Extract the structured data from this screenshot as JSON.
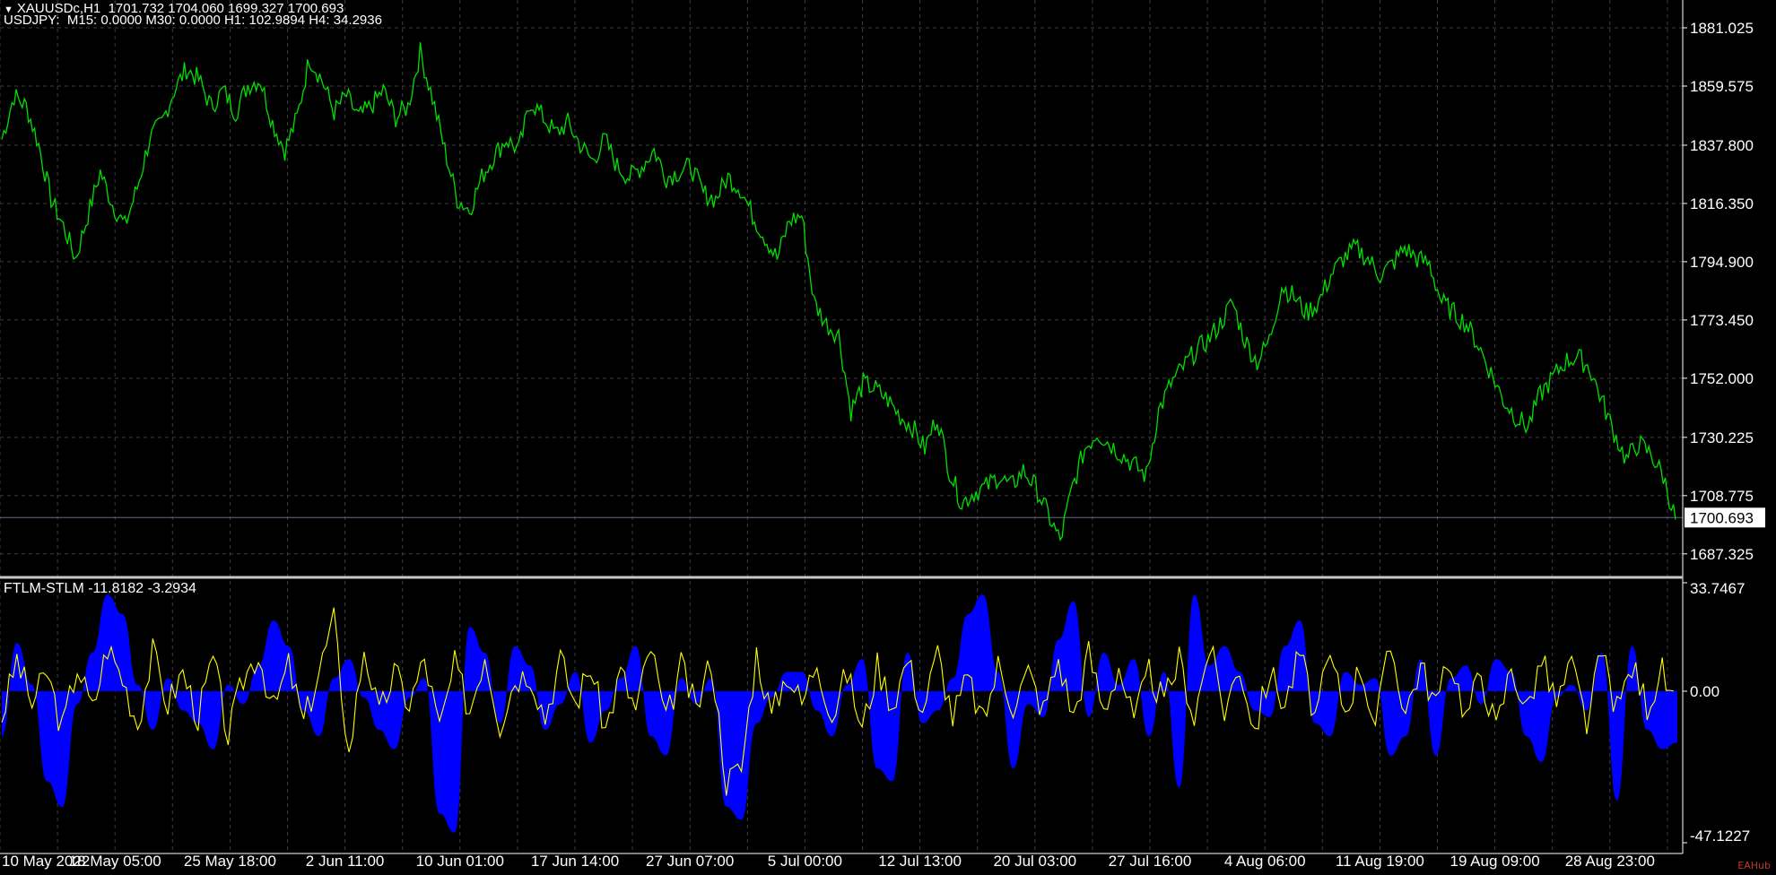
{
  "header": {
    "symbol_line": "XAUUSDc,H1  1701.732 1704.060 1699.327 1700.693",
    "indicator_line": "USDJPY:  M15: 0.0000 M30: 0.0000 H1: 102.9894 H4: 34.2936"
  },
  "indicator": {
    "label": "FTLM-STLM -11.8182 -3.2934"
  },
  "watermark": "EAHub",
  "colors": {
    "background": "#000000",
    "grid": "#3c3c3c",
    "price_line": "#00e000",
    "histogram": "#0000ff",
    "signal_line": "#ffff00",
    "axis_text": "#ffffff",
    "current_price_box": "#ffffff",
    "current_price_line": "#607080",
    "separator": "#c8c8c8"
  },
  "chart_data": [
    {
      "type": "line",
      "title": "XAUUSDc,H1",
      "x_tick_labels": [
        "10 May 2022",
        "18 May 05:00",
        "25 May 18:00",
        "2 Jun 11:00",
        "10 Jun 01:00",
        "17 Jun 14:00",
        "27 Jun 07:00",
        "5 Jul 00:00",
        "12 Jul 13:00",
        "20 Jul 03:00",
        "27 Jul 16:00",
        "4 Aug 06:00",
        "11 Aug 19:00",
        "19 Aug 09:00",
        "28 Aug 23:00"
      ],
      "y_tick_labels": [
        "1881.025",
        "1859.575",
        "1837.800",
        "1816.350",
        "1794.900",
        "1773.450",
        "1752.000",
        "1730.225",
        "1708.775",
        "1687.325"
      ],
      "ylim": [
        1680,
        1884
      ],
      "current_price": "1700.693",
      "series": [
        {
          "values": [
            1840,
            1856,
            1852,
            1838,
            1818,
            1808,
            1796,
            1812,
            1828,
            1816,
            1808,
            1822,
            1840,
            1846,
            1858,
            1866,
            1862,
            1852,
            1858,
            1850,
            1860,
            1862,
            1846,
            1836,
            1848,
            1870,
            1862,
            1850,
            1856,
            1848,
            1852,
            1858,
            1848,
            1852,
            1872,
            1855,
            1836,
            1818,
            1814,
            1826,
            1834,
            1840,
            1836,
            1854,
            1848,
            1842,
            1846,
            1838,
            1832,
            1840,
            1830,
            1826,
            1830,
            1836,
            1826,
            1828,
            1830,
            1820,
            1818,
            1826,
            1822,
            1812,
            1804,
            1796,
            1810,
            1812,
            1780,
            1772,
            1768,
            1740,
            1750,
            1748,
            1744,
            1738,
            1734,
            1726,
            1738,
            1718,
            1706,
            1710,
            1712,
            1716,
            1712,
            1718,
            1712,
            1702,
            1692,
            1712,
            1726,
            1732,
            1728,
            1724,
            1720,
            1716,
            1740,
            1750,
            1756,
            1762,
            1766,
            1772,
            1780,
            1766,
            1758,
            1766,
            1786,
            1782,
            1776,
            1780,
            1790,
            1796,
            1800,
            1796,
            1790,
            1794,
            1800,
            1796,
            1794,
            1780,
            1776,
            1772,
            1764,
            1754,
            1744,
            1738,
            1734,
            1746,
            1752,
            1758,
            1760,
            1756,
            1744,
            1732,
            1722,
            1728,
            1724,
            1716,
            1700
          ]
        }
      ]
    },
    {
      "type": "area",
      "title": "FTLM-STLM",
      "y_tick_labels": [
        "33.7467",
        "0.00",
        "-47.1227"
      ],
      "ylim": [
        -47.1227,
        33.7467
      ],
      "series": [
        {
          "name": "FTLM-STLM",
          "values": [
            -14,
            15,
            2,
            -28,
            -36,
            -4,
            12,
            30,
            24,
            2,
            -12,
            4,
            -6,
            -10,
            -18,
            2,
            -4,
            8,
            22,
            14,
            -6,
            -14,
            4,
            10,
            -2,
            -12,
            -18,
            -2,
            4,
            -38,
            -44,
            20,
            12,
            -10,
            14,
            8,
            -12,
            -4,
            6,
            -16,
            -6,
            4,
            14,
            -14,
            -20,
            4,
            -4,
            4,
            -36,
            -40,
            -10,
            -2,
            6,
            6,
            -6,
            -14,
            2,
            10,
            -24,
            -28,
            12,
            -10,
            -6,
            4,
            24,
            30,
            6,
            -24,
            -4,
            -8,
            16,
            28,
            -8,
            12,
            2,
            10,
            -14,
            6,
            -30,
            30,
            8,
            14,
            6,
            -6,
            -8,
            14,
            22,
            -10,
            -14,
            6,
            2,
            4,
            -20,
            -14,
            10,
            -20,
            4,
            8,
            -4,
            10,
            6,
            -14,
            -22,
            -2,
            2,
            -6,
            12,
            -34,
            14,
            -12,
            -18,
            -16
          ]
        },
        {
          "name": "signal",
          "values": [
            -8,
            10,
            -4,
            6,
            -12,
            8,
            -6,
            14,
            4,
            -10,
            12,
            -4,
            6,
            -8,
            10,
            -14,
            4,
            12,
            -6,
            8,
            -10,
            6,
            22,
            -20,
            14,
            -8,
            6,
            -4,
            10,
            -12,
            8,
            -6,
            12,
            -10,
            4,
            6,
            -8,
            10,
            -4,
            8,
            -12,
            6,
            -6,
            14,
            -10,
            8,
            -6,
            10,
            -28,
            -24,
            12,
            -8,
            6,
            -4,
            10,
            -8,
            6,
            -12,
            8,
            -4,
            10,
            -6,
            12,
            -8,
            4,
            -10,
            8,
            -4,
            6,
            -6,
            10,
            -8,
            12,
            -6,
            8,
            -10,
            6,
            -4,
            10,
            -8,
            14,
            -6,
            8,
            -12,
            6,
            -4,
            12,
            -8,
            10,
            -6,
            8,
            -10,
            14,
            -6,
            8,
            -4,
            10,
            -8,
            6,
            -12,
            8,
            -6,
            10,
            -4,
            8,
            -10,
            12,
            -6,
            8,
            -4,
            6,
            -8
          ]
        }
      ]
    }
  ]
}
